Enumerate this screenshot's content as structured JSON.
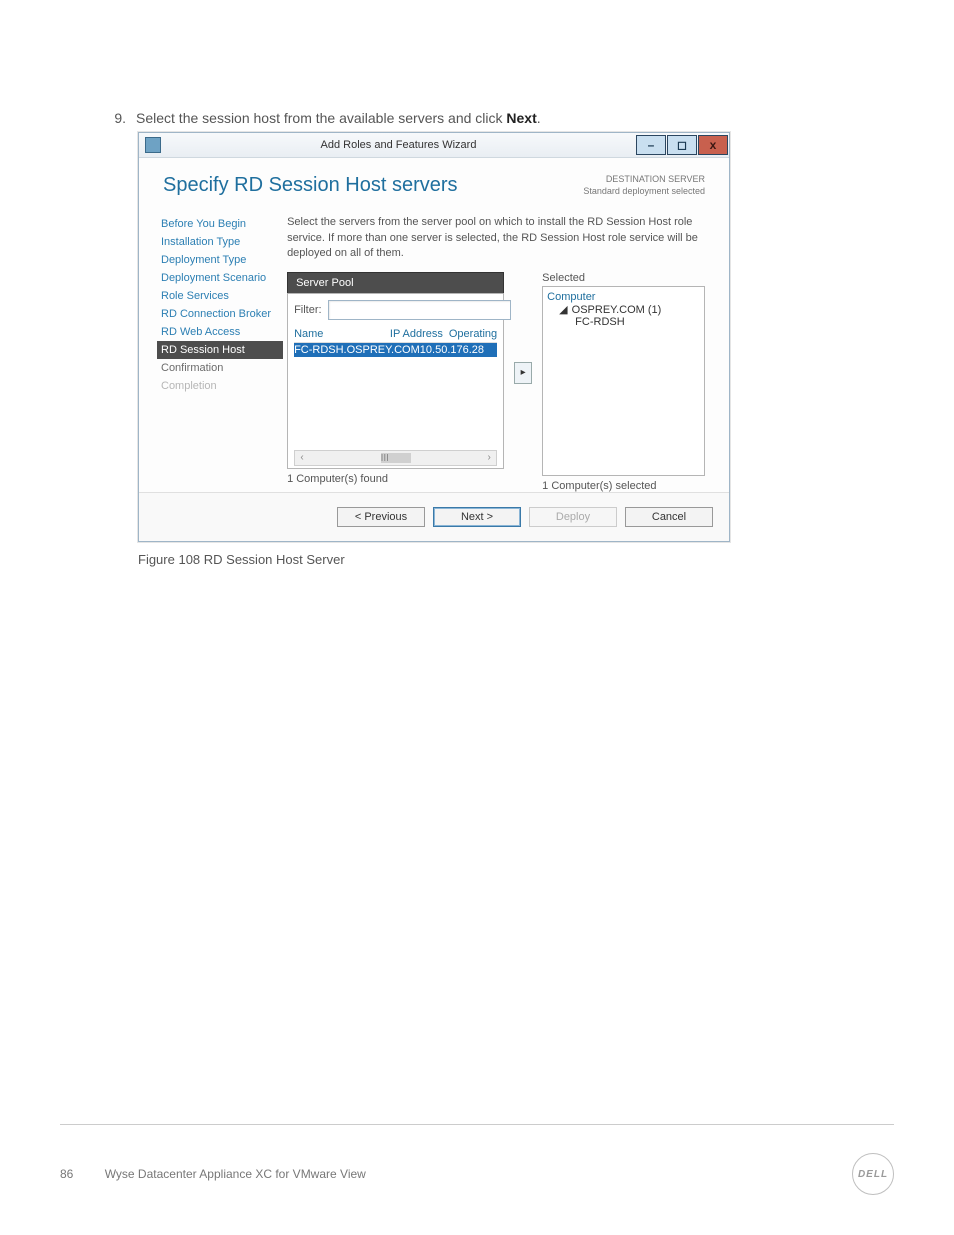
{
  "doc": {
    "step_number": "9.",
    "step_text_a": "Select the session host from the available servers and click ",
    "step_text_b": "Next",
    "step_text_c": ".",
    "figure_caption": "Figure 108  RD Session Host Server",
    "page_number": "86",
    "footer_text": "Wyse Datacenter Appliance XC for VMware View",
    "logo_text": "DELL"
  },
  "wizard": {
    "window_title": "Add Roles and Features Wizard",
    "win_min": "–",
    "win_max": "◻",
    "win_close": "x",
    "page_title": "Specify RD Session Host servers",
    "destination_label": "DESTINATION SERVER",
    "destination_value": "Standard deployment selected",
    "instructions": "Select the servers from the server pool on which to install the RD Session Host role service. If more than one server is selected, the RD Session Host role service will be deployed on all of them.",
    "nav": {
      "items": [
        {
          "label": "Before You Begin",
          "class": "link"
        },
        {
          "label": "Installation Type",
          "class": "link"
        },
        {
          "label": "Deployment Type",
          "class": "link"
        },
        {
          "label": "Deployment Scenario",
          "class": "link"
        },
        {
          "label": "Role Services",
          "class": "link"
        },
        {
          "label": "RD Connection Broker",
          "class": "link"
        },
        {
          "label": "RD Web Access",
          "class": "link"
        },
        {
          "label": "RD Session Host",
          "class": "active"
        },
        {
          "label": "Confirmation",
          "class": ""
        },
        {
          "label": "Completion",
          "class": "disabled"
        }
      ]
    },
    "pool": {
      "header": "Server Pool",
      "filter_label": "Filter:",
      "filter_value": "",
      "columns": {
        "name": "Name",
        "ip": "IP Address",
        "os": "Operating"
      },
      "rows": [
        {
          "name": "FC-RDSH.OSPREY.COM",
          "ip": "10.50.176.28",
          "os": ""
        }
      ],
      "scroll_left": "‹",
      "scroll_mid": "III",
      "scroll_right": "›",
      "footer": "1 Computer(s) found"
    },
    "move_arrow": "▸",
    "selected": {
      "label": "Selected",
      "tree_root": "Computer",
      "tree_toggle": "◢",
      "tree_branch": "OSPREY.COM (1)",
      "tree_leaf": "FC-RDSH",
      "footer": "1 Computer(s) selected"
    },
    "buttons": {
      "previous": "< Previous",
      "next": "Next >",
      "deploy": "Deploy",
      "cancel": "Cancel"
    }
  }
}
